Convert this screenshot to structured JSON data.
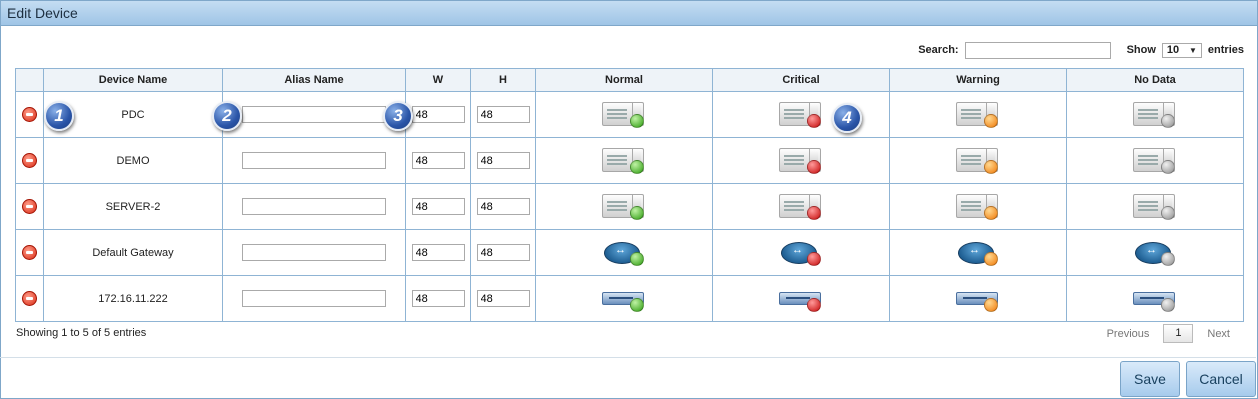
{
  "dialog": {
    "title": "Edit Device"
  },
  "toolbar": {
    "search_label": "Search:",
    "search_value": "",
    "show_label": "Show",
    "show_value": "10",
    "entries_label": "entries"
  },
  "table": {
    "columns": [
      "Device Name",
      "Alias Name",
      "W",
      "H",
      "Normal",
      "Critical",
      "Warning",
      "No Data"
    ],
    "rows": [
      {
        "name": "PDC",
        "alias": "",
        "w": "48",
        "h": "48",
        "icon_type": "server"
      },
      {
        "name": "DEMO",
        "alias": "",
        "w": "48",
        "h": "48",
        "icon_type": "server"
      },
      {
        "name": "SERVER-2",
        "alias": "",
        "w": "48",
        "h": "48",
        "icon_type": "server"
      },
      {
        "name": "Default Gateway",
        "alias": "",
        "w": "48",
        "h": "48",
        "icon_type": "router"
      },
      {
        "name": "172.16.11.222",
        "alias": "",
        "w": "48",
        "h": "48",
        "icon_type": "switch"
      }
    ],
    "status_colors": {
      "normal": "#2e9d10",
      "critical": "#c60b0b",
      "warning": "#f07a08",
      "nodata": "#8c8c8c"
    }
  },
  "badges": [
    "1",
    "2",
    "3",
    "4"
  ],
  "pager": {
    "info": "Showing 1 to 5 of 5 entries",
    "previous": "Previous",
    "page": "1",
    "next": "Next"
  },
  "buttons": {
    "save": "Save",
    "cancel": "Cancel"
  }
}
